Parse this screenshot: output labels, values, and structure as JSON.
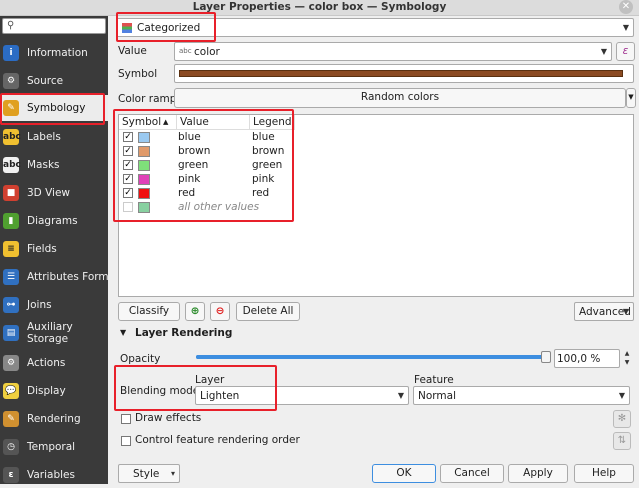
{
  "window": {
    "title": "Layer Properties — color box — Symbology",
    "close_glyph": "✕"
  },
  "sidebar": {
    "search_placeholder": "",
    "items": [
      {
        "label": "Information",
        "icon": "info-icon"
      },
      {
        "label": "Source",
        "icon": "source-icon"
      },
      {
        "label": "Symbology",
        "icon": "symbology-icon"
      },
      {
        "label": "Labels",
        "icon": "labels-icon",
        "glyph": "abc"
      },
      {
        "label": "Masks",
        "icon": "masks-icon",
        "glyph": "abc"
      },
      {
        "label": "3D View",
        "icon": "3d-view-icon"
      },
      {
        "label": "Diagrams",
        "icon": "diagrams-icon"
      },
      {
        "label": "Fields",
        "icon": "fields-icon"
      },
      {
        "label": "Attributes Form",
        "icon": "attributes-form-icon"
      },
      {
        "label": "Joins",
        "icon": "joins-icon"
      },
      {
        "label": "Auxiliary",
        "label2": "Storage",
        "icon": "auxiliary-storage-icon"
      },
      {
        "label": "Actions",
        "icon": "actions-icon"
      },
      {
        "label": "Display",
        "icon": "display-icon"
      },
      {
        "label": "Rendering",
        "icon": "rendering-icon"
      },
      {
        "label": "Temporal",
        "icon": "temporal-icon"
      },
      {
        "label": "Variables",
        "icon": "variables-icon"
      }
    ]
  },
  "renderer": {
    "type": "Categorized"
  },
  "value_row": {
    "label": "Value",
    "field_prefix": "abc",
    "field": "color",
    "expr_glyph": "ε"
  },
  "symbol_row": {
    "label": "Symbol",
    "color": "#8b4a22"
  },
  "ramp_row": {
    "label": "Color ramp",
    "value": "Random colors"
  },
  "table": {
    "headers": {
      "symbol": "Symbol",
      "value": "Value",
      "legend": "Legend",
      "sort_glyph": "▲"
    },
    "rows": [
      {
        "checked": true,
        "color": "#9ac9f0",
        "value": "blue",
        "legend": "blue"
      },
      {
        "checked": true,
        "color": "#e09a6a",
        "value": "brown",
        "legend": "brown"
      },
      {
        "checked": true,
        "color": "#7fe07a",
        "value": "green",
        "legend": "green"
      },
      {
        "checked": true,
        "color": "#e040b8",
        "value": "pink",
        "legend": "pink"
      },
      {
        "checked": true,
        "color": "#f01010",
        "value": "red",
        "legend": "red"
      },
      {
        "checked": false,
        "color": "#88d0a0",
        "value": "all other values",
        "legend": "",
        "italic": true
      }
    ]
  },
  "actions": {
    "classify": "Classify",
    "delete_all": "Delete All",
    "advanced": "Advanced"
  },
  "layer_rendering": {
    "title": "Layer Rendering",
    "opacity_label": "Opacity",
    "opacity_value": "100,0 %",
    "opacity_fraction": 1.0,
    "blending_label": "Blending mode",
    "layer_label": "Layer",
    "layer_value": "Lighten",
    "feature_label": "Feature",
    "feature_value": "Normal",
    "draw_effects": "Draw effects",
    "control_order": "Control feature rendering order"
  },
  "footer": {
    "style": "Style",
    "ok": "OK",
    "cancel": "Cancel",
    "apply": "Apply",
    "help": "Help"
  }
}
